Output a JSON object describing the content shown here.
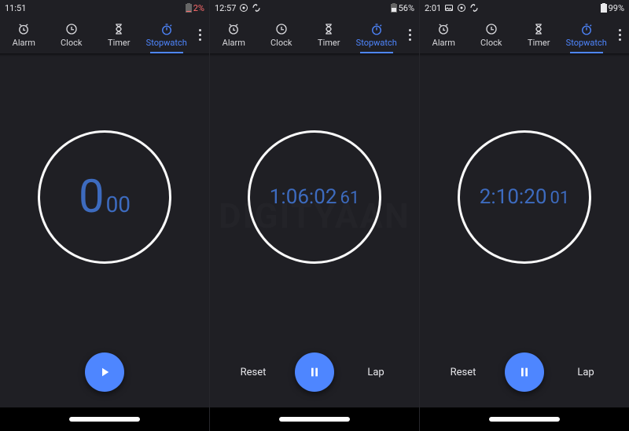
{
  "accent": "#4e86ff",
  "tabs": {
    "alarm": "Alarm",
    "clock": "Clock",
    "timer": "Timer",
    "stopwatch": "Stopwatch"
  },
  "buttons": {
    "reset": "Reset",
    "lap": "Lap"
  },
  "screens": [
    {
      "status": {
        "time": "11:51",
        "battery_pct": "2%",
        "battery_color": "#ff6b6b",
        "icons": []
      },
      "stopwatch": {
        "main": "0",
        "hundredths": "00"
      },
      "controls": {
        "mode": "play"
      }
    },
    {
      "status": {
        "time": "12:57",
        "battery_pct": "56%",
        "battery_color": "#e9e9ec",
        "icons": [
          "camera-icon",
          "sync-icon"
        ]
      },
      "stopwatch": {
        "main": "1:06:02",
        "hundredths": "61"
      },
      "controls": {
        "mode": "pause"
      }
    },
    {
      "status": {
        "time": "2:01",
        "battery_pct": "99%",
        "battery_color": "#e9e9ec",
        "icons": [
          "gallery-icon",
          "camera-icon",
          "sync-icon"
        ]
      },
      "stopwatch": {
        "main": "2:10:20",
        "hundredths": "01"
      },
      "controls": {
        "mode": "pause"
      }
    }
  ],
  "watermark": "DIGITYAAN"
}
